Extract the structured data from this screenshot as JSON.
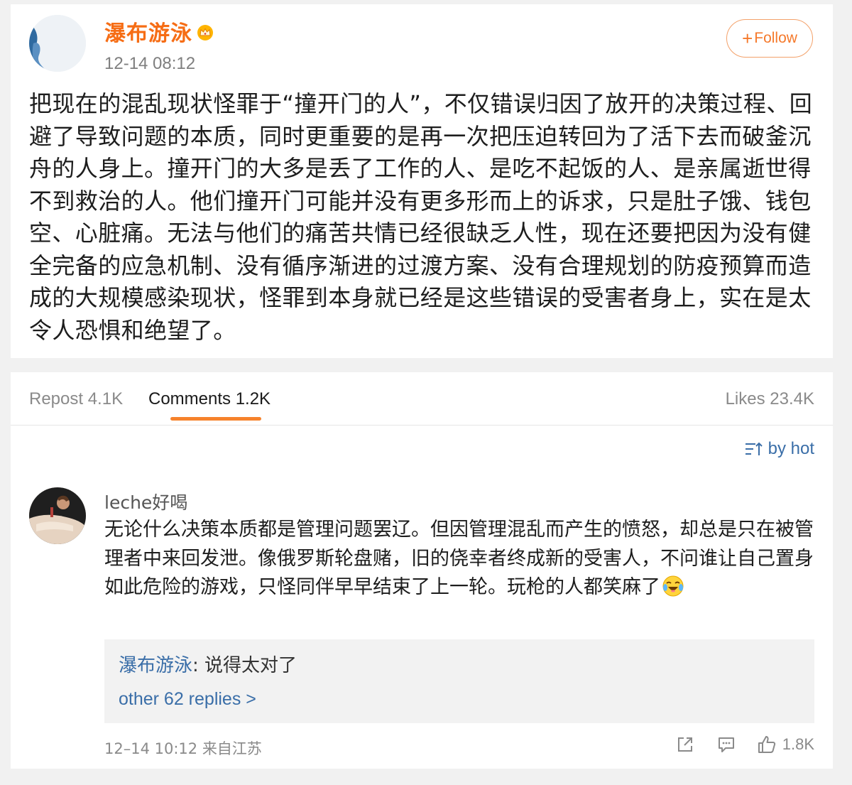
{
  "post": {
    "username": "瀑布游泳",
    "timestamp": "12-14 08:12",
    "follow_plus": "+",
    "follow_label": "Follow",
    "text": "把现在的混乱现状怪罪于“撞开门的人”，不仅错误归因了放开的决策过程、回避了导致问题的本质，同时更重要的是再一次把压迫转回为了活下去而破釜沉舟的人身上。撞开门的大多是丢了工作的人、是吃不起饭的人、是亲属逝世得不到救治的人。他们撞开门可能并没有更多形而上的诉求，只是肚子饿、钱包空、心脏痛。无法与他们的痛苦共情已经很缺乏人性，现在还要把因为没有健全完备的应急机制、没有循序渐进的过渡方案、没有合理规划的防疫预算而造成的大规模感染现状，怪罪到本身就已经是这些错误的受害者身上，实在是太令人恐惧和绝望了。"
  },
  "tabs": {
    "repost": "Repost 4.1K",
    "comments": "Comments 1.2K",
    "likes": "Likes 23.4K"
  },
  "sort_label": "by hot",
  "comment": {
    "username": "leche好喝",
    "text": "无论什么决策本质都是管理问题罢辽。但因管理混乱而产生的愤怒，却总是只在被管理者中来回发泄。像俄罗斯轮盘赌，旧的侥幸者终成新的受害人，不问谁让自己置身如此危险的游戏，只怪同伴早早结束了上一轮。玩枪的人都笑麻了",
    "reply_user": "瀑布游泳",
    "reply_sep": ": ",
    "reply_text": "说得太对了",
    "more_replies": "other 62 replies >",
    "meta": "12–14 10:12 来自江苏",
    "like_count": "1.8K"
  },
  "colors": {
    "username_orange": "#f66d15",
    "link_blue": "#3a6ea8",
    "tab_accent": "#f6822c"
  },
  "icons": [
    "crown-icon",
    "plus-icon",
    "sort-icon",
    "share-icon",
    "comment-icon",
    "thumbs-up-icon",
    "laughing-crying-emoji"
  ]
}
